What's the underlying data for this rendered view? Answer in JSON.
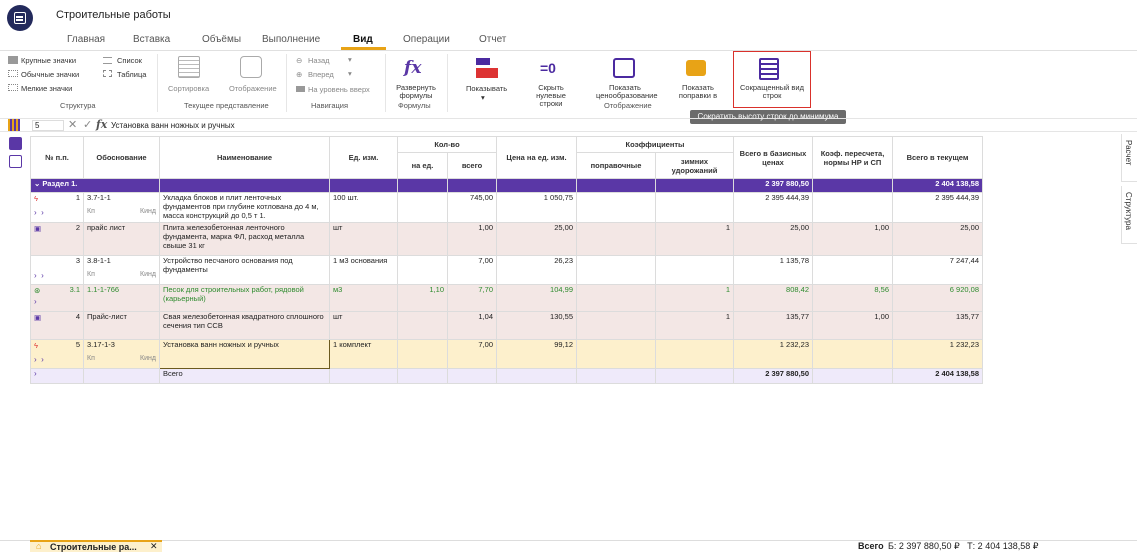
{
  "app": {
    "title": "Строительные работы"
  },
  "menu": {
    "tabs": [
      "Главная",
      "Вставка",
      "Объёмы",
      "Выполнение",
      "Вид",
      "Операции",
      "Отчет"
    ],
    "active": "Вид"
  },
  "ribbon": {
    "structure": {
      "large": "Крупные значки",
      "list": "Список",
      "normal": "Обычные значки",
      "table": "Таблица",
      "small": "Мелкие значки",
      "group": "Структура"
    },
    "current_view": {
      "sort": "Сортировка",
      "display": "Отображение",
      "group": "Текущее представление"
    },
    "navigation": {
      "back": "Назад",
      "forward": "Вперед",
      "level_up": "На уровень вверх",
      "group": "Навигация"
    },
    "formulas": {
      "expand": "Развернуть формулы",
      "group": "Формулы"
    },
    "display": {
      "show": "Показывать",
      "hide_zero": "Скрыть нулевые строки",
      "pricing": "Показать ценообразование",
      "corrections": "Показать поправки в",
      "group": "Отображение"
    },
    "compact": {
      "label": "Сокращенный вид строк"
    },
    "tooltip": "Сократить высоту строк до минимума"
  },
  "formula_bar": {
    "cell_ref": "5",
    "content": "Установка ванн ножных и ручных"
  },
  "table": {
    "headers": {
      "num": "№ п.п.",
      "basis": "Обоснование",
      "name": "Наименование",
      "unit": "Ед. изм.",
      "qty": "Кол-во",
      "qty_unit": "на ед.",
      "qty_total": "всего",
      "price": "Цена на ед. изм.",
      "coef": "Коэффициенты",
      "coef_corr": "поправочные",
      "coef_winter": "зимних удорожаний",
      "base_total": "Всего в базисных ценах",
      "recalc": "Коэф. пересчета, нормы НР и СП",
      "current_total": "Всего в текущем"
    },
    "section": {
      "label": "Раздел 1.",
      "base": "2 397 880,50",
      "current": "2 404 138,58"
    },
    "rows": [
      {
        "num": "1",
        "basis": "3.7-1-1",
        "kp": "Кп",
        "kind": "Кинд",
        "name": "Укладка блоков и плит ленточных фундаментов при глубине котлована до 4 м, масса конструкций до 0,5 т 1.",
        "unit": "100 шт.",
        "qty_unit": "",
        "qty_total": "745,00",
        "price": "1 050,75",
        "corr": "",
        "winter": "",
        "base": "2 395 444,39",
        "recalc": "",
        "current": "2 395 444,39"
      },
      {
        "num": "2",
        "basis": "прайс лист",
        "name": "Плита железобетонная ленточного фундамента, марка ФЛ, расход металла свыше 31 кг",
        "unit": "шт",
        "qty_unit": "",
        "qty_total": "1,00",
        "price": "25,00",
        "corr": "",
        "winter": "1",
        "base": "25,00",
        "recalc": "1,00",
        "current": "25,00"
      },
      {
        "num": "3",
        "basis": "3.8-1-1",
        "kp": "Кп",
        "kind": "Кинд",
        "name": "Устройство песчаного основания под фундаменты",
        "unit": "1 м3 основания",
        "qty_unit": "",
        "qty_total": "7,00",
        "price": "26,23",
        "corr": "",
        "winter": "",
        "base": "1 135,78",
        "recalc": "",
        "current": "7 247,44"
      },
      {
        "num": "3.1",
        "basis": "1.1-1-766",
        "name": "Песок для строительных работ, рядовой (карьерный)",
        "unit": "м3",
        "qty_unit": "1,10",
        "qty_total": "7,70",
        "price": "104,99",
        "corr": "",
        "winter": "1",
        "base": "808,42",
        "recalc": "8,56",
        "current": "6 920,08"
      },
      {
        "num": "4",
        "basis": "Прайс-лист",
        "name": "Свая железобетонная квадратного сплошного сечения тип ССВ",
        "unit": "шт",
        "qty_unit": "",
        "qty_total": "1,04",
        "price": "130,55",
        "corr": "",
        "winter": "1",
        "base": "135,77",
        "recalc": "1,00",
        "current": "135,77"
      },
      {
        "num": "5",
        "basis": "3.17-1-3",
        "kp": "Кп",
        "kind": "Кинд",
        "name": "Установка ванн ножных и ручных",
        "unit": "1 комплект",
        "qty_unit": "",
        "qty_total": "7,00",
        "price": "99,12",
        "corr": "",
        "winter": "",
        "base": "1 232,23",
        "recalc": "",
        "current": "1 232,23"
      }
    ],
    "total": {
      "label": "Всего",
      "base": "2 397 880,50",
      "current": "2 404 138,58"
    }
  },
  "side_tabs": {
    "calc": "Расчет",
    "structure": "Структура"
  },
  "bottom": {
    "doc_tab": "Строительные ра...",
    "total_label": "Всего",
    "total_values": "Б: 2 397 880,50 ₽   Т: 2 404 138,58 ₽"
  }
}
